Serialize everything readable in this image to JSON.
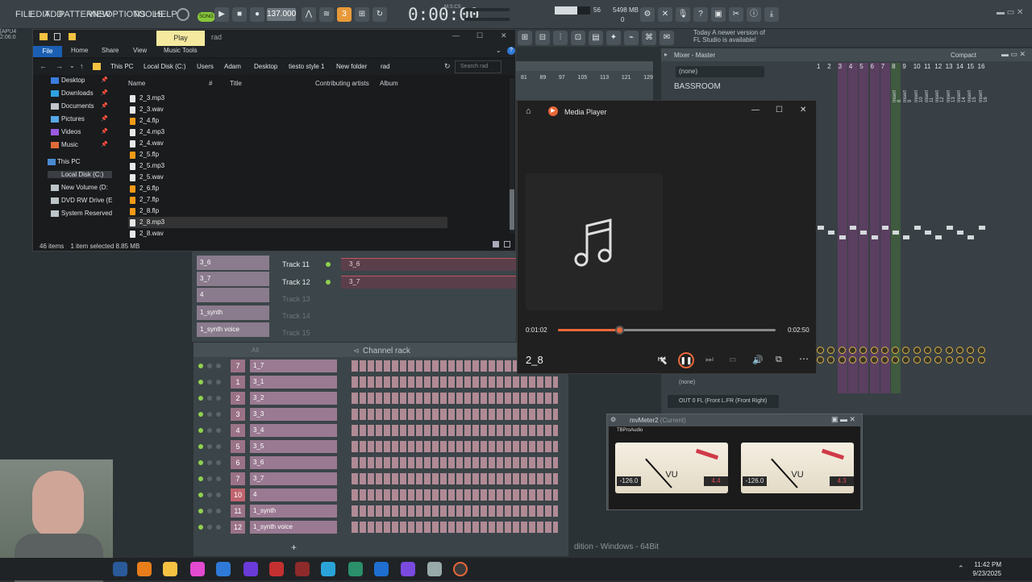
{
  "fl_menu": [
    "FILE",
    "EDIT",
    "ADD",
    "PATTERNS",
    "VIEW",
    "OPTIONS",
    "TOOLS",
    "HELP"
  ],
  "fl_info": {
    "left_top": "[APU4",
    "left_bottom": "2:06:0"
  },
  "transport": {
    "song_label": "SONG",
    "tempo": "137.000",
    "time": "0:00:00",
    "time_unit": "M:S:CS",
    "cpu": "56",
    "mem": "5498 MB",
    "polyphony": "0",
    "pattern_num": "3"
  },
  "news": {
    "line1": "Today  A newer version of",
    "line2": "FL Studio is available!"
  },
  "explorer": {
    "quick_access_tab": "Play",
    "window_title": "rad",
    "ribbon_tabs": [
      "File",
      "Home",
      "Share",
      "View",
      "Music Tools"
    ],
    "breadcrumb": [
      "This PC",
      "Local Disk (C:)",
      "Users",
      "Adam",
      "Desktop",
      "tiesto style 1",
      "New folder",
      "rad"
    ],
    "search_placeholder": "Search rad",
    "nav_items": [
      {
        "label": "Desktop",
        "pinned": true
      },
      {
        "label": "Downloads",
        "pinned": true
      },
      {
        "label": "Documents",
        "pinned": true
      },
      {
        "label": "Pictures",
        "pinned": true
      },
      {
        "label": "Videos",
        "pinned": true
      },
      {
        "label": "Music",
        "pinned": true
      },
      {
        "label": "This PC",
        "pinned": false
      },
      {
        "label": "Local Disk (C:)",
        "pinned": false
      },
      {
        "label": "New Volume (D:",
        "pinned": false
      },
      {
        "label": "DVD RW Drive (E",
        "pinned": false
      },
      {
        "label": "System Reserved",
        "pinned": false
      }
    ],
    "columns": [
      "Name",
      "#",
      "Title",
      "Contributing artists",
      "Album"
    ],
    "files": [
      "2_3.mp3",
      "2_3.wav",
      "2_4.flp",
      "2_4.mp3",
      "2_4.wav",
      "2_5.flp",
      "2_5.mp3",
      "2_5.wav",
      "2_6.flp",
      "2_7.flp",
      "2_8.flp",
      "2_8.mp3",
      "2_8.wav"
    ],
    "selected_file": "2_8.mp3",
    "status_items": "46 items",
    "status_selected": "1 item selected  8.85 MB"
  },
  "playlist": {
    "ruler": [
      "81",
      "89",
      "97",
      "105",
      "113",
      "121",
      "129"
    ],
    "pads": [
      "3_6",
      "3_7",
      "4",
      "1_synth",
      "1_synth voice"
    ],
    "tracks": [
      {
        "label": "Track 11",
        "clip": "3_6",
        "active": true
      },
      {
        "label": "Track 12",
        "clip": "3_7",
        "active": true
      },
      {
        "label": "Track 13",
        "clip": "",
        "active": false
      },
      {
        "label": "Track 14",
        "clip": "",
        "active": false
      },
      {
        "label": "Track 15",
        "clip": "",
        "active": false
      }
    ]
  },
  "channel_rack": {
    "title": "Channel rack",
    "filter": "All",
    "channels": [
      {
        "num": "7",
        "name": "1_7"
      },
      {
        "num": "1",
        "name": "3_1"
      },
      {
        "num": "2",
        "name": "3_2"
      },
      {
        "num": "3",
        "name": "3_3"
      },
      {
        "num": "4",
        "name": "3_4"
      },
      {
        "num": "5",
        "name": "3_5"
      },
      {
        "num": "6",
        "name": "3_6"
      },
      {
        "num": "7",
        "name": "3_7"
      },
      {
        "num": "10",
        "name": "4"
      },
      {
        "num": "11",
        "name": "1_synth"
      },
      {
        "num": "12",
        "name": "1_synth voice"
      }
    ],
    "add_label": "+"
  },
  "media_player": {
    "app_title": "Media Player",
    "current_time": "0:01:02",
    "total_time": "0:02:50",
    "progress": 0.28,
    "song_title": "2_8"
  },
  "mixer": {
    "title": "Mixer - Master",
    "view_mode": "Compact",
    "insert_slot": "(none)",
    "plugin": "BASSROOM",
    "numbers": [
      "1",
      "2",
      "3",
      "4",
      "5",
      "6",
      "7",
      "8",
      "9",
      "10",
      "11",
      "12",
      "13",
      "14",
      "15",
      "16"
    ],
    "insert_labels": [
      "Insert 8",
      "Insert 9",
      "Insert 10",
      "Insert 11",
      "Insert 12",
      "Insert 13",
      "Insert 14",
      "Insert 15",
      "Insert 16"
    ],
    "bottom_slot": "(none)",
    "output": "OUT 0 FL (Front L.FR (Front Right)"
  },
  "meter": {
    "title": "mvMeter2",
    "title_suffix": "(Current)",
    "brand": "TBProAudio",
    "left": {
      "label": "VU",
      "peak": "-126.0",
      "value": "4.4"
    },
    "right": {
      "label": "VU",
      "peak": "-126.0",
      "value": "4.3"
    }
  },
  "fl_bottom": "dition - Windows - 64Bit",
  "clock": {
    "time": "11:42 PM",
    "date": "9/23/2025"
  },
  "colors": {
    "accent_orange": "#e8673a",
    "fl_green": "#87c63a",
    "explorer_blue": "#1a5fb4"
  }
}
